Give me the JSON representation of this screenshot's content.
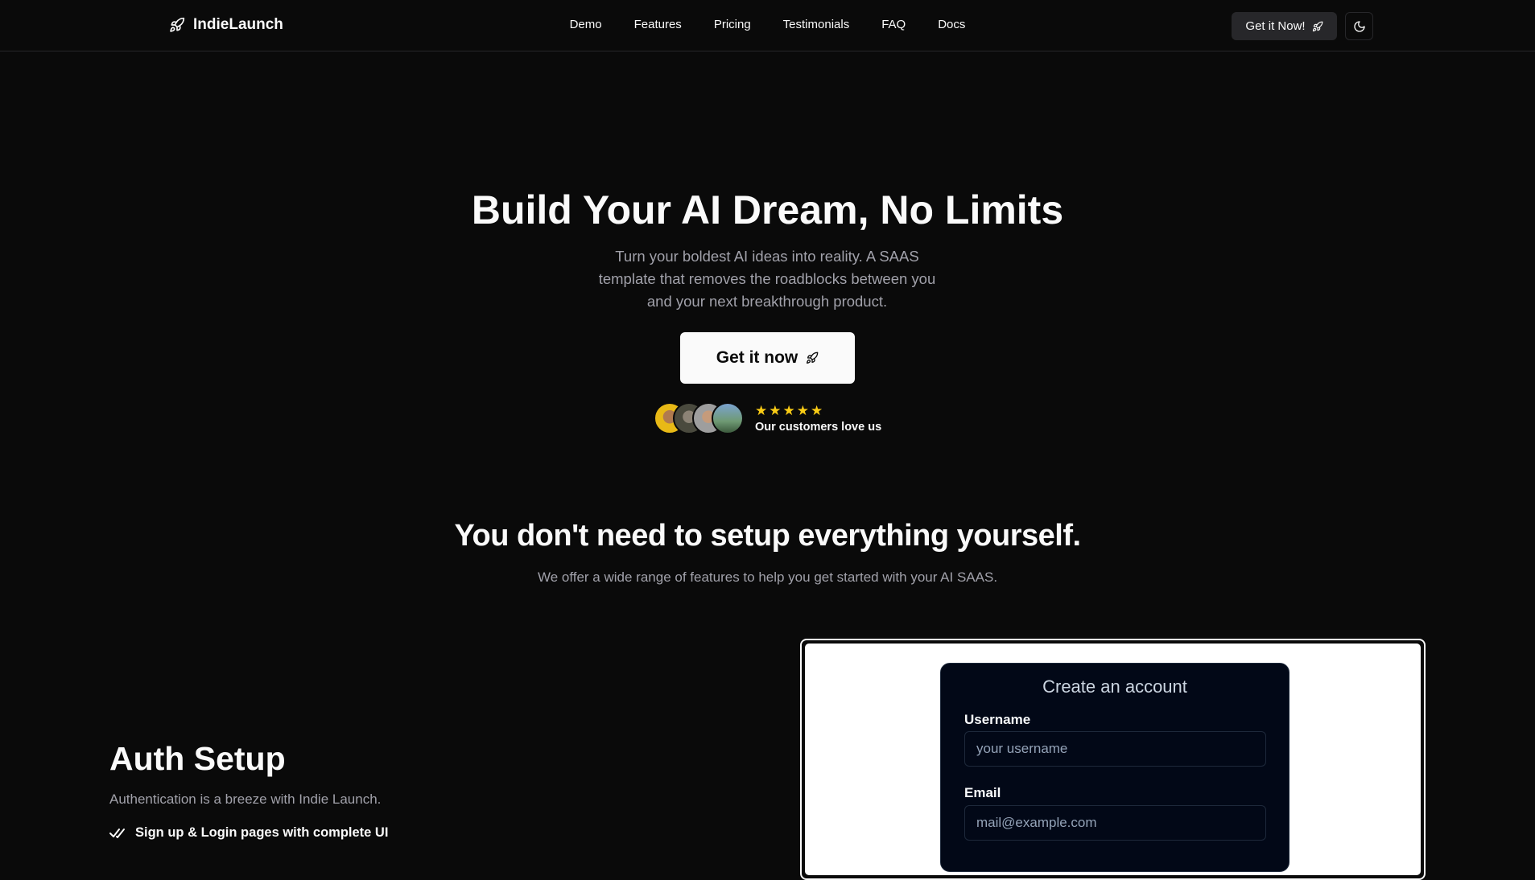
{
  "nav": {
    "brand": "IndieLaunch",
    "links": [
      "Demo",
      "Features",
      "Pricing",
      "Testimonials",
      "FAQ",
      "Docs"
    ],
    "cta": "Get it Now!",
    "theme_icon": "moon-icon"
  },
  "hero": {
    "title": "Build Your AI Dream, No Limits",
    "subtitle": "Turn your boldest AI ideas into reality. A SAAS template that removes the roadblocks between you and your next breakthrough product.",
    "button": "Get it now",
    "rating": 5,
    "social_text": "Our customers love us"
  },
  "features_section": {
    "title": "You don't need to setup everything yourself.",
    "subtitle": "We offer a wide range of features to help you get started with your AI SAAS."
  },
  "feature": {
    "title": "Auth Setup",
    "description": "Authentication is a breeze with Indie Launch.",
    "bullet": "Sign up & Login pages with complete UI"
  },
  "signup_preview": {
    "title": "Create an account",
    "username_label": "Username",
    "username_placeholder": "your username",
    "email_label": "Email",
    "email_placeholder": "mail@example.com"
  },
  "colors": {
    "background": "#0a0a0a",
    "star": "#facc15",
    "muted_text": "#a1a1aa"
  }
}
